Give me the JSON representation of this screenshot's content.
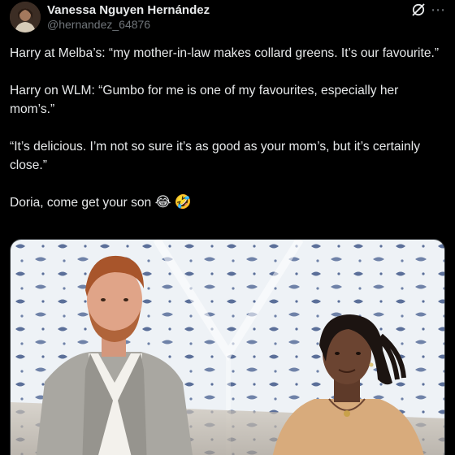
{
  "author": {
    "display_name": "Vanessa Nguyen Hernández",
    "handle": "@hernandez_64876",
    "avatar_icon": "profile-photo-avatar"
  },
  "header_icons": {
    "grok": "grok-icon",
    "more": "more-options-icon",
    "more_glyph": "⋯"
  },
  "tweet": {
    "paragraphs": [
      "Harry at Melba’s: “my mother-in-law makes collard greens. It’s our favourite.”",
      "Harry on WLM: “Gumbo for me is one of my favourites, especially her mom’s.”",
      "“It’s delicious. I’m not so sure it’s as good as your mom’s, but it’s certainly close.”"
    ],
    "closing_text": "Doria, come get your son",
    "emojis": [
      "😂",
      "🤣"
    ]
  },
  "media": {
    "icon": "photo-media",
    "colors": {
      "tent": "#eef2f6",
      "tent_pattern": "#5b6f99",
      "skin_left": "#e0a488",
      "hair_left": "#a8552b",
      "jacket_left": "#a9a7a1",
      "shirt_left": "#f3f1ec",
      "skin_right": "#6b4431",
      "hair_right": "#1c1411",
      "sweater_right": "#d8ab7c"
    }
  },
  "colors": {
    "background": "#000000",
    "text": "#e7e9ea",
    "secondary_text": "#71767b"
  }
}
